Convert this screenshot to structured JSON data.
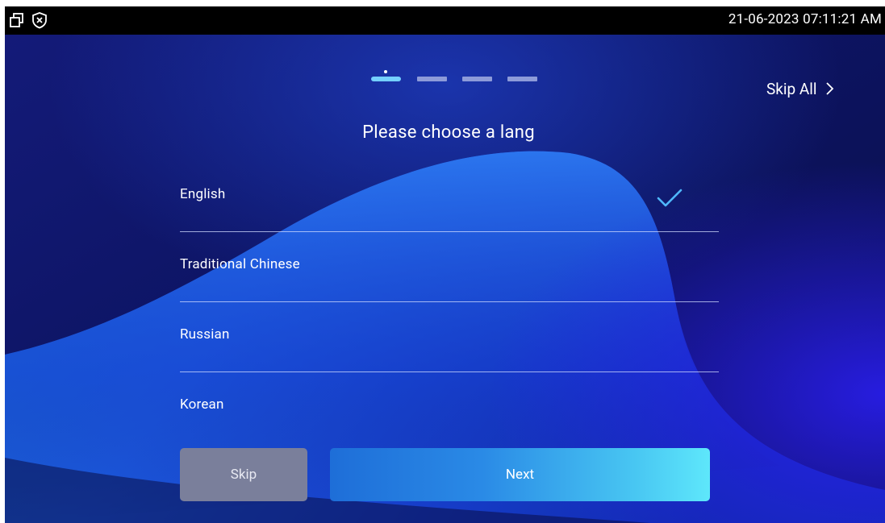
{
  "status_bar": {
    "datetime": "21-06-2023 07:11:21 AM",
    "icons": [
      "window-restore-icon",
      "shield-x-icon"
    ]
  },
  "wizard": {
    "total_steps": 4,
    "current_step": 1,
    "skip_all_label": "Skip All",
    "title": "Please choose a lang"
  },
  "languages": [
    {
      "label": "English",
      "selected": true
    },
    {
      "label": "Traditional Chinese",
      "selected": false
    },
    {
      "label": "Russian",
      "selected": false
    },
    {
      "label": "Korean",
      "selected": false
    }
  ],
  "buttons": {
    "skip_label": "Skip",
    "next_label": "Next"
  },
  "colors": {
    "background": "#0a0f4d",
    "accent": "#4fb8ff",
    "next_button_start": "#1e6ed8",
    "next_button_end": "#5ee7fb",
    "skip_button": "#7a7f9b",
    "check": "#4fb8ff"
  }
}
